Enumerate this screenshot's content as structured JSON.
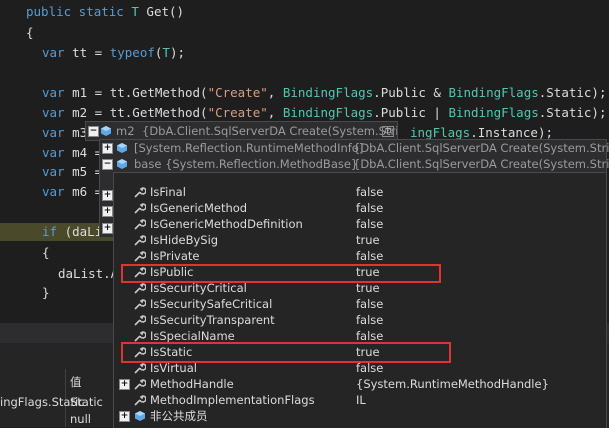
{
  "code": {
    "line1": {
      "kw": "public static",
      "type": "T",
      "rest": " Get()"
    },
    "brace_open": "{",
    "line3": {
      "kw": "var",
      "mid": " tt = ",
      "kw2": "typeof",
      "p1": "(",
      "type": "T",
      "p2": ");"
    },
    "m1": {
      "kw": "var",
      "pre": " m1 = tt.GetMethod(",
      "str": "\"Create\"",
      "mid": ", ",
      "t1": "BindingFlags",
      "m2": ".Public & ",
      "t2": "BindingFlags",
      "end": ".Static);"
    },
    "m2": {
      "kw": "var",
      "pre": " m2 = tt.GetMethod(",
      "str": "\"Create\"",
      "mid": ", ",
      "t1": "BindingFlags",
      "m2": ".Public | ",
      "t2": "BindingFlags",
      "end": ".Static);"
    },
    "m3": {
      "kw": "var",
      "pre": " m3",
      "tail_type": "ingFlags",
      "tail": ".Instance);"
    },
    "m4": {
      "kw": "var",
      "pre": " m4 ="
    },
    "m5": {
      "kw": "var",
      "pre": " m5 ="
    },
    "m6": {
      "kw": "var",
      "pre": " m6 ="
    },
    "if_line": {
      "kw": "if",
      "rest": " (daList"
    },
    "brace2": "{",
    "add_line": "daList.Ad",
    "brace_close": "}"
  },
  "tooltip": {
    "head_name": "m2",
    "head_value": "{DbA.Client.SqlServerDA Create(System.String)}",
    "sub": [
      {
        "name": "[System.Reflection.RuntimeMethodInfo]",
        "value": "{DbA.Client.SqlServerDA Create(System.String)}"
      },
      {
        "name": "base {System.Reflection.MethodBase}",
        "value": "{DbA.Client.SqlServerDA Create(System.String)}"
      }
    ]
  },
  "properties": [
    {
      "name": "IsFinal",
      "value": "false",
      "expandable": false
    },
    {
      "name": "IsGenericMethod",
      "value": "false",
      "expandable": false
    },
    {
      "name": "IsGenericMethodDefinition",
      "value": "false",
      "expandable": false
    },
    {
      "name": "IsHideBySig",
      "value": "true",
      "expandable": false
    },
    {
      "name": "IsPrivate",
      "value": "false",
      "expandable": false
    },
    {
      "name": "IsPublic",
      "value": "true",
      "expandable": false,
      "highlight": true
    },
    {
      "name": "IsSecurityCritical",
      "value": "true",
      "expandable": false
    },
    {
      "name": "IsSecuritySafeCritical",
      "value": "false",
      "expandable": false
    },
    {
      "name": "IsSecurityTransparent",
      "value": "false",
      "expandable": false
    },
    {
      "name": "IsSpecialName",
      "value": "false",
      "expandable": false
    },
    {
      "name": "IsStatic",
      "value": "true",
      "expandable": false,
      "highlight": true
    },
    {
      "name": "IsVirtual",
      "value": "false",
      "expandable": false
    },
    {
      "name": "MethodHandle",
      "value": "{System.RuntimeMethodHandle}",
      "expandable": true
    },
    {
      "name": "MethodImplementationFlags",
      "value": "IL",
      "expandable": false
    },
    {
      "name": "非公共成员",
      "value": "",
      "expandable": true,
      "icon": "cube"
    }
  ],
  "locals": {
    "header_value": "值",
    "rows": [
      {
        "name": "ingFlags.Static",
        "value": "Static"
      },
      {
        "name": "",
        "value": "null"
      }
    ]
  },
  "colors": {
    "highlight_border": "#e03333",
    "keyword": "#569cd6",
    "type": "#4ec9b0",
    "string": "#d69d85"
  }
}
